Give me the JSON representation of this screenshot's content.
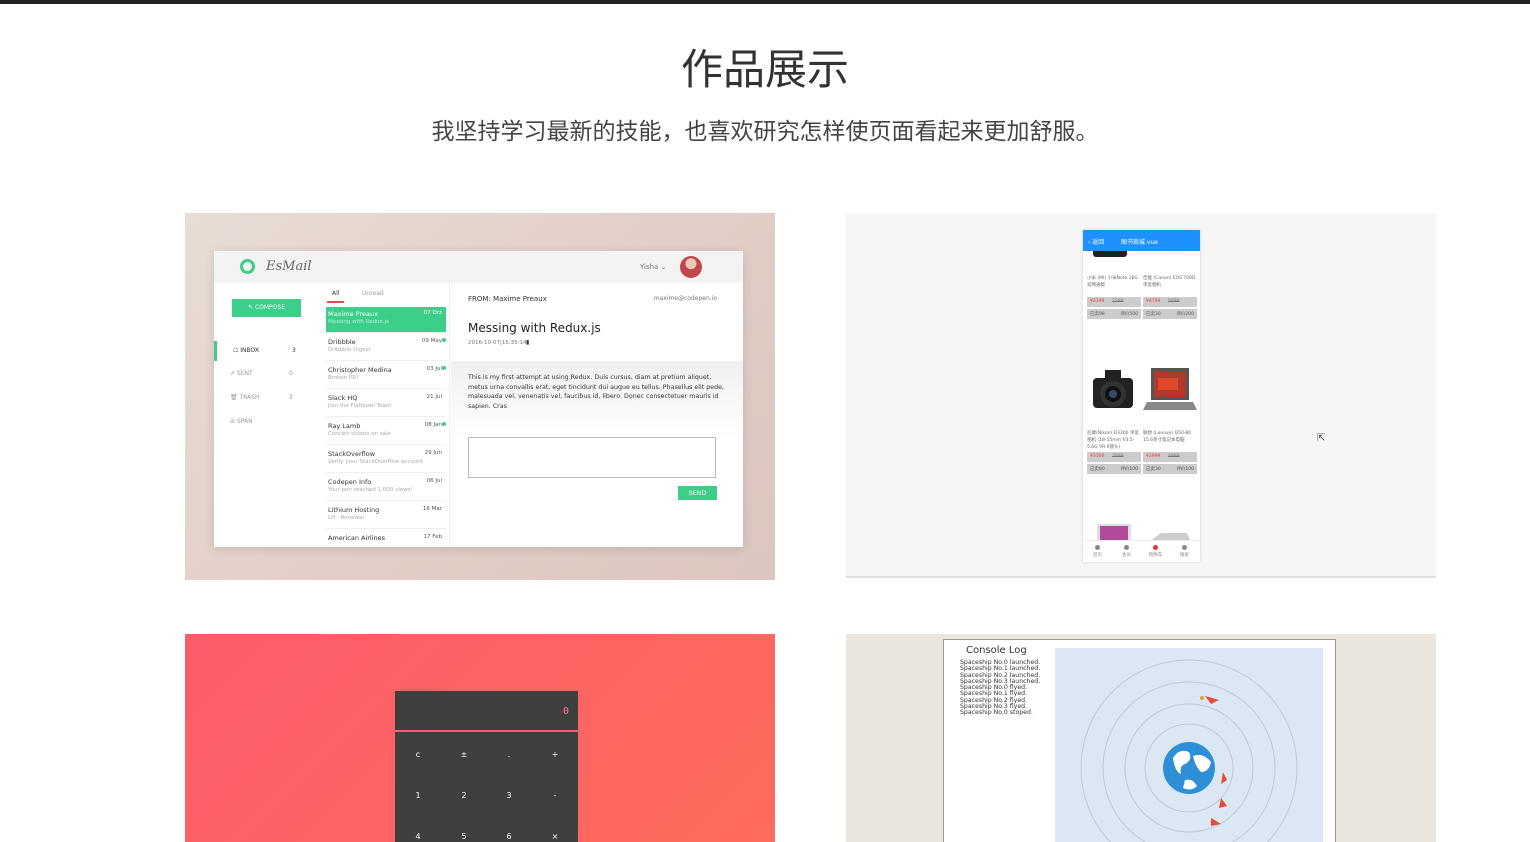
{
  "page": {
    "title": "作品展示",
    "subtitle": "我坚持学习最新的技能，也喜欢研究怎样使页面看起来更加舒服。"
  },
  "esmail": {
    "logo": "EsMail",
    "user": "Yisha ⌄",
    "compose": "✎ COMPOSE",
    "nav": [
      {
        "label": "☖ INBOX",
        "count": "3"
      },
      {
        "label": "➚ SENT",
        "count": "0"
      },
      {
        "label": "🗑 TRASH",
        "count": "3"
      },
      {
        "label": "⊘ SPAN",
        "count": ""
      }
    ],
    "tabs": {
      "all": "All",
      "unread": "Unread"
    },
    "mails": [
      {
        "from": "Maxime Preaux",
        "snippet": "Messing with Redux.js",
        "date": "07 Oct"
      },
      {
        "from": "Dribbble",
        "snippet": "Dribbble Digest",
        "date": "09 May"
      },
      {
        "from": "Christopher Medina",
        "snippet": "Broken PR?",
        "date": "03 Jul"
      },
      {
        "from": "Slack HQ",
        "snippet": "Join the Flahbowl Team",
        "date": "21 Jul"
      },
      {
        "from": "Ray Lamb",
        "snippet": "Concert tickets on sale",
        "date": "08 Jan"
      },
      {
        "from": "StackOverflow",
        "snippet": "Verify your StackOverflow account",
        "date": "29 Jun"
      },
      {
        "from": "Codepen Info",
        "snippet": "Your pen reached 1,000 views!",
        "date": "06 Jul"
      },
      {
        "from": "Lithium Hosting",
        "snippet": "LH - Renewal",
        "date": "16 Mar"
      },
      {
        "from": "American Airlines",
        "snippet": "",
        "date": "17 Feb"
      }
    ],
    "reader": {
      "from": "FROM: Maxime Preaux",
      "email": "maxime@codepen.io",
      "subject": "Messing with Redux.js",
      "date": "2016-10-07|15:35:14",
      "body": "This is my first attempt at using Redux. Duis cursus, diam at pretium aliquet, metus urna convallis erat, eget tincidunt dui augue eu tellus. Phasellus elit pede, malesuada vel, venenatis vel, faucibus id, libero. Donec consectetuer mauris id sapien. Cras",
      "send": "SEND"
    }
  },
  "shop": {
    "back": "‹ 返回",
    "title": "图书商城.vue",
    "products": [
      {
        "name": "小米 (MI) 小米Note 16G 双网通版",
        "price": "¥2199",
        "old": "2599",
        "a": "已卖98",
        "b": "评价500"
      },
      {
        "name": "佳能 (Canon) EOS 700D 单反相机",
        "price": "¥4799",
        "old": "5699",
        "a": "已卖30",
        "b": "评价200"
      },
      {
        "name": "尼康(Nikon) D3300 单反相机 (18-55mm f/3.5-5.6G VR II镜头)",
        "price": "¥3100",
        "old": "3999",
        "a": "已卖80",
        "b": "评价100"
      },
      {
        "name": "联想 (Lenovo) G50-80 15.6英寸笔记本电脑",
        "price": "¥2999",
        "old": "4999",
        "a": "已卖30",
        "b": "评价100"
      }
    ],
    "tabs": [
      "首页",
      "会员",
      "购物车",
      "搜索"
    ]
  },
  "calc": {
    "display": "0",
    "keys": [
      "c",
      "±",
      ".",
      "+",
      "1",
      "2",
      "3",
      "-",
      "4",
      "5",
      "6",
      "×"
    ]
  },
  "space": {
    "title": "Console Log",
    "log": [
      "Spaceship No.0 launched.",
      "Spaceship No.1 launched.",
      "Spaceship No.2 launched.",
      "Spaceship No.3 launched.",
      "Spaceship No.0 flyed.",
      "Spaceship No.1 flyed.",
      "Spaceship No.2 flyed.",
      "Spaceship No.3 flyed.",
      "Spaceship No.0 stoped."
    ]
  },
  "colors": {
    "accent_green": "#3bcf8a",
    "shop_blue": "#1e90ff",
    "calc_red": "#ff5d6b"
  }
}
